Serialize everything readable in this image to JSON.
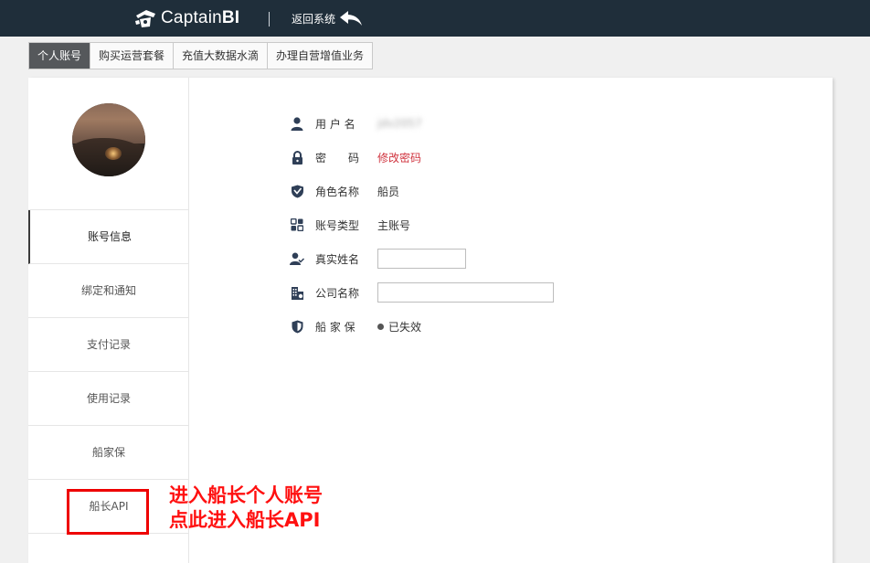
{
  "header": {
    "brand_prefix": "Captain",
    "brand_suffix": "BI",
    "back_label": "返回系统"
  },
  "tabs": [
    {
      "label": "个人账号",
      "active": true
    },
    {
      "label": "购买运营套餐",
      "active": false
    },
    {
      "label": "充值大数据水滴",
      "active": false
    },
    {
      "label": "办理自营增值业务",
      "active": false
    }
  ],
  "sidebar": {
    "items": [
      {
        "label": "账号信息",
        "active": true
      },
      {
        "label": "绑定和通知",
        "active": false
      },
      {
        "label": "支付记录",
        "active": false
      },
      {
        "label": "使用记录",
        "active": false
      },
      {
        "label": "船家保",
        "active": false
      },
      {
        "label": "船长API",
        "active": false
      }
    ]
  },
  "account": {
    "username_label": "用 户 名",
    "username_value": "jdv2057",
    "password_label": "密　　码",
    "password_action": "修改密码",
    "role_label": "角色名称",
    "role_value": "船员",
    "type_label": "账号类型",
    "type_value": "主账号",
    "realname_label": "真实姓名",
    "realname_value": "",
    "company_label": "公司名称",
    "company_value": "",
    "insurance_label": "船 家 保",
    "insurance_status": "已失效"
  },
  "annotation": {
    "line1": "进入船长个人账号",
    "line2": "点此进入船长API"
  },
  "colors": {
    "topbar": "#1f2e3a",
    "active_tab": "#55585b",
    "link": "#d0343f",
    "annotation": "#ff1010"
  }
}
